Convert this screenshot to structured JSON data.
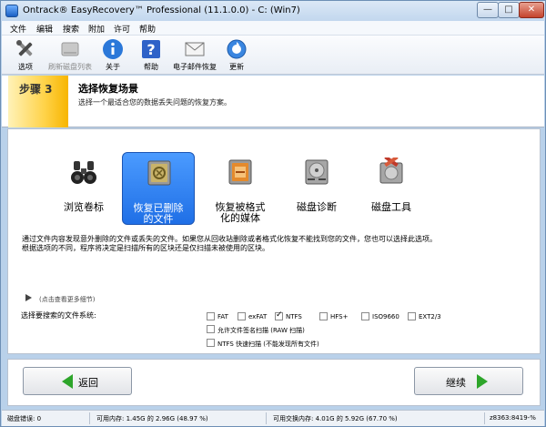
{
  "window": {
    "title": "Ontrack® EasyRecovery™ Professional (11.1.0.0) - C: (Win7)",
    "min_label": "—",
    "max_label": "□",
    "close_label": "✕"
  },
  "menu": [
    "文件",
    "编辑",
    "搜索",
    "附加",
    "许可",
    "帮助"
  ],
  "toolbar": {
    "items": [
      {
        "label": "选项",
        "icon": "tools-icon",
        "enabled": true
      },
      {
        "label": "刷新磁盘列表",
        "icon": "disk-refresh-icon",
        "enabled": false
      },
      {
        "label": "关于",
        "icon": "info-icon",
        "enabled": true
      },
      {
        "label": "帮助",
        "icon": "help-icon",
        "enabled": true
      },
      {
        "label": "电子邮件恢复",
        "icon": "email-icon",
        "enabled": true
      },
      {
        "label": "更新",
        "icon": "update-icon",
        "enabled": true
      }
    ]
  },
  "step": {
    "badge": "步骤 3",
    "title": "选择恢复场景",
    "subtitle": "选择一个最适合您的数据丢失问题的恢复方案。"
  },
  "scenarios": [
    {
      "label_line1": "浏览卷标",
      "label_line2": "",
      "icon": "binoculars-icon",
      "selected": false
    },
    {
      "label_line1": "恢复已删除",
      "label_line2": "的文件",
      "icon": "recycle-bin-icon",
      "selected": true
    },
    {
      "label_line1": "恢复被格式",
      "label_line2": "化的媒体",
      "icon": "format-disk-icon",
      "selected": false
    },
    {
      "label_line1": "磁盘诊断",
      "label_line2": "",
      "icon": "disk-diagnostic-icon",
      "selected": false
    },
    {
      "label_line1": "磁盘工具",
      "label_line2": "",
      "icon": "disk-tools-icon",
      "selected": false
    }
  ],
  "description": {
    "line1": "通过文件内容发现意外删除的文件或丢失的文件。如果您从回收站删除或者格式化恢复不能找到您的文件，您也可以选择此选项。",
    "line2": "根据选项的不同，程序将决定是扫描所有的区块还是仅扫描未被使用的区块。"
  },
  "more_details": "(点击查看更多细节)",
  "filesystem": {
    "label": "选择要搜索的文件系统:",
    "options": [
      {
        "label": "FAT",
        "checked": false
      },
      {
        "label": "exFAT",
        "checked": false
      },
      {
        "label": "NTFS",
        "checked": true
      },
      {
        "label": "HFS+",
        "checked": false
      },
      {
        "label": "ISO9660",
        "checked": false
      },
      {
        "label": "EXT2/3",
        "checked": false
      }
    ],
    "raw_scan": {
      "label": "允许文件签名扫描 (RAW 扫描)",
      "checked": false
    },
    "ntfs_quick": {
      "label": "NTFS 快速扫描 (不能发现所有文件)",
      "checked": false
    }
  },
  "nav": {
    "back_label": "返回",
    "next_label": "继续"
  },
  "status": {
    "disk_errors": "磁盘错误: 0",
    "memory": "可用内存: 1.45G 的 2.96G (48.97 %)",
    "swap": "可用交换内存: 4.01G 的 5.92G (67.70 %)",
    "code": "z8363:8419-%"
  },
  "colors": {
    "selected_blue": "#2f84f2",
    "step_yellow": "#ffd34a",
    "arrow_green": "#2da52a"
  }
}
